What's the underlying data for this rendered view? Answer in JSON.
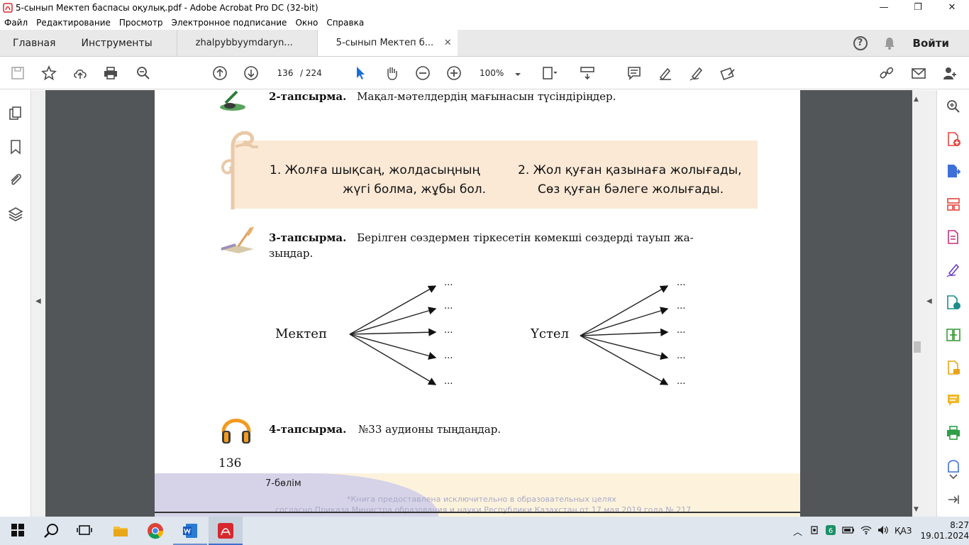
{
  "window": {
    "title": "5-сынып Мектеп баспасы оқулық.pdf - Adobe Acrobat Pro DC (32-bit)",
    "minimize": "—",
    "maximize": "❐",
    "close": "✕"
  },
  "menu": [
    "Файл",
    "Редактирование",
    "Просмотр",
    "Электронное подписание",
    "Окно",
    "Справка"
  ],
  "tabs": {
    "home": "Главная",
    "tools": "Инструменты",
    "doc1": "zhalpybbyymdaryn...",
    "doc2": "5-сынып Мектеп б...",
    "close": "✕",
    "help": "?",
    "signin": "Войти"
  },
  "toolbar": {
    "page_current": "136",
    "page_total": "/  224",
    "zoom": "100%"
  },
  "page": {
    "task2_label": "2-тапсырма.",
    "task2_text": "Мақал-мәтелдердің    мағынасын    түсіндіріңдер.",
    "proverb1_line1": "1.  Жолға шықсаң, жолдасыңның",
    "proverb1_line2": "жүгі болма, жұбы бол.",
    "proverb2_line1": "2.  Жол қуған қазынаға жолығады,",
    "proverb2_line2": "Сөз қуған бәлеге жолығады.",
    "task3_label": "3-тапсырма.",
    "task3_text": "Берілген    сөздермен    тіркесетін    көмекші    сөздерді    тауып    жа-",
    "task3_text2": "зыңдар.",
    "word1": "Мектеп",
    "word2": "Үстел",
    "ellipsis": "...",
    "task4_label": "4-тапсырма.",
    "task4_text": "№33    аудионы    тыңдаңдар.",
    "page_number": "136",
    "section": "7-бөлім",
    "watermark1": "*Книга предоставлена исключительно в образовательных целях",
    "watermark2": "согласно Приказа Министра образования и науки Республики Казахстан от 17 мая 2019 года № 217"
  },
  "taskbar": {
    "lang": "ҚАЗ",
    "time": "8:27",
    "date": "19.01.2024"
  },
  "colors": {
    "acrobat_red": "#d7282f",
    "band": "#fbe9d6",
    "viewer_bg": "#525659"
  }
}
